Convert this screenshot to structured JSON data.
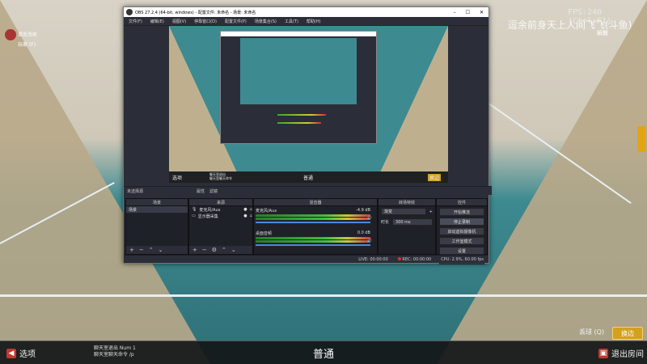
{
  "game": {
    "fps_label": "FPS:240 (Ctrl+F1)",
    "watermark": "逗余前身天上人间飞飞(斗鱼)",
    "player_name": "退出当前",
    "player_sub": "玩家 (F)",
    "right_tag": "解散",
    "mode": "普通",
    "chat_line1": "聊天室退出  Num 1",
    "chat_line2": "聊天室聊天命令  /p",
    "options_label": "选项",
    "exit_room_label": "退出房间",
    "throw_label": "丢球 (Q)",
    "switch_label": "换边",
    "accent": "#d4a11e"
  },
  "obs": {
    "title": "OBS 27.2.4 (64-bit, windows) - 配置文件: 未命名 - 场景: 未命名",
    "menu": [
      "文件(F)",
      "编辑(E)",
      "视图(V)",
      "停靠窗口(D)",
      "配置文件(P)",
      "场景集合(S)",
      "工具(T)",
      "帮助(H)"
    ],
    "window_controls": [
      "–",
      "☐",
      "✕"
    ],
    "preview_mode": "普通",
    "preview_buttons": [
      "选项",
      "换边"
    ],
    "preview_chat": [
      "聊天室退出",
      "聊天室聊天命令"
    ],
    "dockbar": {
      "label": "未选择源",
      "properties": "属性",
      "filters": "滤镜"
    },
    "scenes": {
      "header": "场景",
      "items": [
        "场景"
      ]
    },
    "sources": {
      "header": "来源",
      "items": [
        "麦克风/Aux",
        "显示器采集"
      ]
    },
    "mixer": {
      "header": "混音器",
      "channels": [
        {
          "name": "麦克风/Aux",
          "db": "-4.9 dB",
          "level": 0.72
        },
        {
          "name": "桌面音频",
          "db": "0.0 dB",
          "level": 0.85
        }
      ]
    },
    "transitions": {
      "header": "转场特效",
      "type": "渐变",
      "duration_label": "时长",
      "duration": "300 ms"
    },
    "controls": {
      "header": "控件",
      "buttons": [
        "开始推流",
        "停止录制",
        "启动虚拟摄像机",
        "工作室模式",
        "设置",
        "退出"
      ]
    },
    "status": {
      "live": "LIVE: 00:00:00",
      "rec": "REC: 00:00:00",
      "cpu": "CPU: 2.9%, 60.00 fps"
    }
  }
}
